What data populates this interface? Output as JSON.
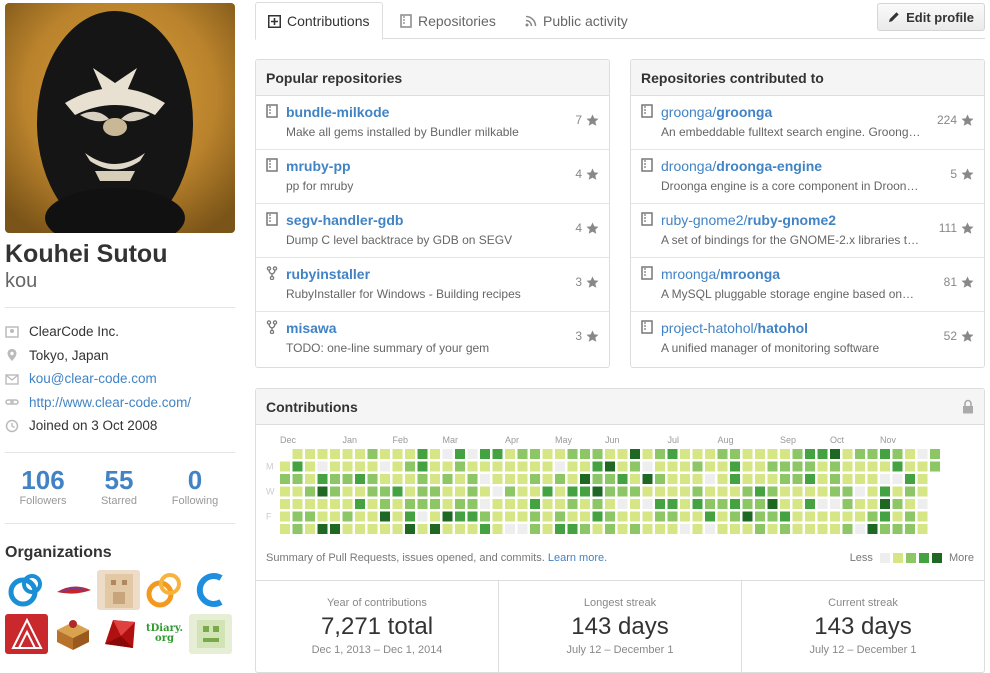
{
  "profile": {
    "fullname": "Kouhei Sutou",
    "username": "kou",
    "details": [
      {
        "icon": "organization-icon",
        "text": "ClearCode Inc.",
        "link": false
      },
      {
        "icon": "location-icon",
        "text": "Tokyo, Japan",
        "link": false
      },
      {
        "icon": "mail-icon",
        "text": "kou@clear-code.com",
        "link": true
      },
      {
        "icon": "link-icon",
        "text": "http://www.clear-code.com/",
        "link": true
      },
      {
        "icon": "clock-icon",
        "text": "Joined on 3 Oct 2008",
        "link": false
      }
    ],
    "stats": [
      {
        "num": "106",
        "label": "Followers"
      },
      {
        "num": "55",
        "label": "Starred"
      },
      {
        "num": "0",
        "label": "Following"
      }
    ],
    "orgs_title": "Organizations",
    "orgs": [
      "groonga-org",
      "feather-org",
      "mrkun-org",
      "ring-orange-org",
      "ring-blue-org",
      "tokyo-org",
      "box-org",
      "ruby-org",
      "tdiary-org",
      "robot-org"
    ],
    "tdiary_text": "tDiary.org"
  },
  "tabs": [
    {
      "label": "Contributions",
      "icon": "plus-square-icon",
      "active": true
    },
    {
      "label": "Repositories",
      "icon": "repo-icon",
      "active": false
    },
    {
      "label": "Public activity",
      "icon": "rss-icon",
      "active": false
    }
  ],
  "edit_profile_label": "Edit profile",
  "popular": {
    "title": "Popular repositories",
    "repos": [
      {
        "name": "bundle-milkode",
        "desc": "Make all gems installed by Bundler milkable",
        "stars": "7",
        "fork": false
      },
      {
        "name": "mruby-pp",
        "desc": "pp for mruby",
        "stars": "4",
        "fork": false
      },
      {
        "name": "segv-handler-gdb",
        "desc": "Dump C level backtrace by GDB on SEGV",
        "stars": "4",
        "fork": false
      },
      {
        "name": "rubyinstaller",
        "desc": "RubyInstaller for Windows - Building recipes",
        "stars": "3",
        "fork": true
      },
      {
        "name": "misawa",
        "desc": "TODO: one-line summary of your gem",
        "stars": "3",
        "fork": true
      }
    ]
  },
  "contributed": {
    "title": "Repositories contributed to",
    "repos": [
      {
        "owner": "groonga/",
        "name": "groonga",
        "desc": "An embeddable fulltext search engine. Groonga is…",
        "stars": "224"
      },
      {
        "owner": "droonga/",
        "name": "droonga-engine",
        "desc": "Droonga engine is a core component in Droonga…",
        "stars": "5"
      },
      {
        "owner": "ruby-gnome2/",
        "name": "ruby-gnome2",
        "desc": "A set of bindings for the GNOME-2.x libraries to…",
        "stars": "111"
      },
      {
        "owner": "mroonga/",
        "name": "mroonga",
        "desc": "A MySQL pluggable storage engine based on…",
        "stars": "81"
      },
      {
        "owner": "project-hatohol/",
        "name": "hatohol",
        "desc": "A unified manager of monitoring software",
        "stars": "52"
      }
    ]
  },
  "contributions": {
    "title": "Contributions",
    "months": [
      "Dec",
      "Jan",
      "Feb",
      "Mar",
      "Apr",
      "May",
      "Jun",
      "Jul",
      "Aug",
      "Sep",
      "Oct",
      "Nov"
    ],
    "days": [
      "M",
      "W",
      "F"
    ],
    "summary": "Summary of Pull Requests, issues opened, and commits.",
    "learn_more": "Learn more.",
    "less": "Less",
    "more": "More",
    "colors": [
      "#eeeeee",
      "#d6e685",
      "#8cc665",
      "#44a340",
      "#1e6823"
    ],
    "streaks": [
      {
        "label": "Year of contributions",
        "value": "7,271 total",
        "dates": "Dec 1, 2013 – Dec 1, 2014"
      },
      {
        "label": "Longest streak",
        "value": "143 days",
        "dates": "July 12 – December 1"
      },
      {
        "label": "Current streak",
        "value": "143 days",
        "dates": "July 12 – December 1"
      }
    ]
  }
}
